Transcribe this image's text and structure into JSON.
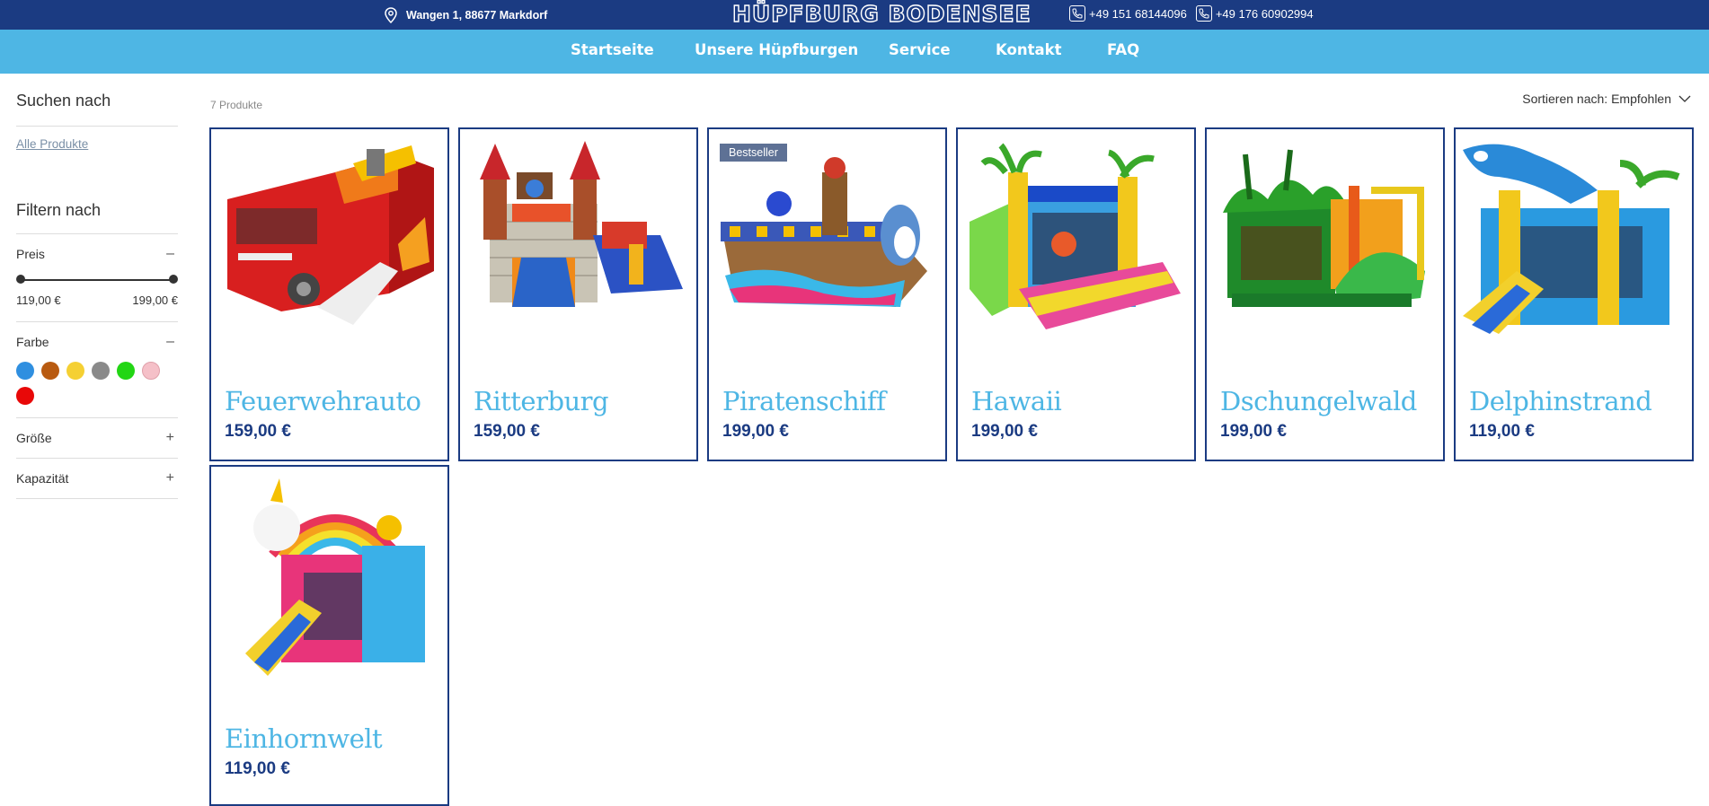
{
  "header": {
    "address": "Wangen 1, 88677 Markdorf",
    "logo_text": "HÜPFBURG BODENSEE",
    "phone1": "+49 151 68144096",
    "phone2": "+49 176 60902994"
  },
  "nav": {
    "items": [
      {
        "label": "Startseite"
      },
      {
        "label": "Unsere Hüpfburgen"
      },
      {
        "label": "Service"
      },
      {
        "label": "Kontakt"
      },
      {
        "label": "FAQ"
      }
    ]
  },
  "sidebar": {
    "search_title": "Suchen nach",
    "all_products": "Alle Produkte",
    "filter_title": "Filtern nach",
    "price_label": "Preis",
    "price_min": "119,00 €",
    "price_max": "199,00 €",
    "color_label": "Farbe",
    "colors": [
      "#2f8fe0",
      "#b85a10",
      "#f5d033",
      "#8a8a8a",
      "#22d614",
      "#f5c0c8",
      "#e80808"
    ],
    "size_label": "Größe",
    "capacity_label": "Kapazität",
    "expanded_sign": "–",
    "collapsed_sign": "+"
  },
  "main": {
    "count": "7 Produkte",
    "sort_label": "Sortieren nach: Empfohlen"
  },
  "products": [
    {
      "name": "Feuerwehrauto",
      "price": "159,00 €",
      "badge": ""
    },
    {
      "name": "Ritterburg",
      "price": "159,00 €",
      "badge": ""
    },
    {
      "name": "Piratenschiff",
      "price": "199,00 €",
      "badge": "Bestseller"
    },
    {
      "name": "Hawaii",
      "price": "199,00 €",
      "badge": ""
    },
    {
      "name": "Dschungelwald",
      "price": "199,00 €",
      "badge": ""
    },
    {
      "name": "Delphinstrand",
      "price": "119,00 €",
      "badge": ""
    },
    {
      "name": "Einhornwelt",
      "price": "119,00 €",
      "badge": ""
    }
  ],
  "colors": {
    "navy": "#1b3b82",
    "sky": "#4eb6e4"
  }
}
